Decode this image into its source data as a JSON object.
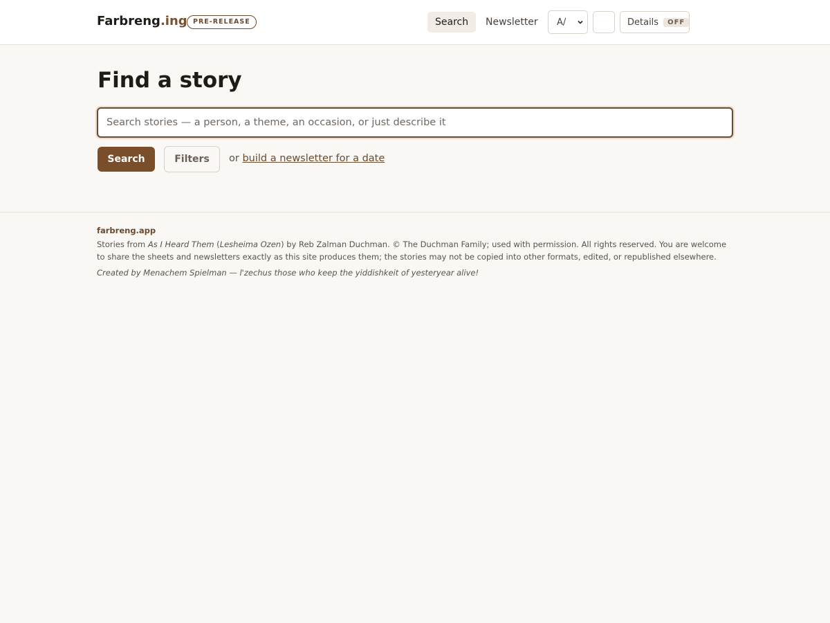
{
  "header": {
    "brand_main": "Farbreng",
    "brand_suffix": ".ing",
    "badge": "PRE-RELEASE",
    "nav_search": "Search",
    "nav_newsletter": "Newsletter",
    "text_size_value": "A/",
    "details_label": "Details",
    "details_state": "OFF"
  },
  "main": {
    "title": "Find a story",
    "search_placeholder": "Search stories — a person, a theme, an occasion, or just describe it",
    "search_button": "Search",
    "filters_button": "Filters",
    "or_text": "or",
    "newsletter_link": "build a newsletter for a date"
  },
  "footer": {
    "site": "farbreng.app",
    "line_prefix": "Stories from ",
    "book_title": "As I Heard Them",
    "open_paren": " (",
    "book_alt": "Lesheima Ozen",
    "line_rest": ") by Reb Zalman Duchman. © The Duchman Family; used with permission. All rights reserved. You are welcome to share the sheets and newsletters exactly as this site produces them; the stories may not be copied into other formats, edited, or republished elsewhere.",
    "credit": "Created by Menachem Spielman — l'zechus those who keep the yiddishkeit of yesteryear alive!"
  },
  "colors": {
    "accent": "#7a4e2b",
    "background": "#f9f8f5"
  },
  "icons": {
    "select_chevron": "chevron-down-icon"
  }
}
